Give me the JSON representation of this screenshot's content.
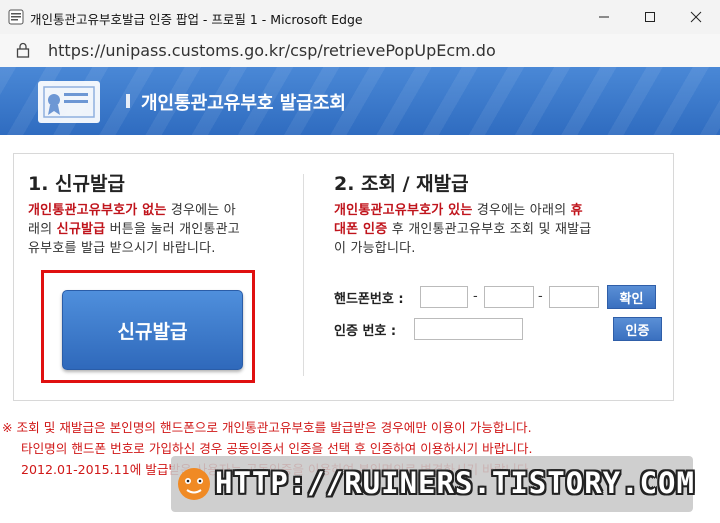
{
  "window": {
    "title": "개인통관고유부호발급 인증 팝업 - 프로필 1 - Microsoft Edge",
    "url": "https://unipass.customs.go.kr/csp/retrievePopUpEcm.do"
  },
  "banner": {
    "heading": "개인통관고유부호 발급조회"
  },
  "new_issue": {
    "heading": "1. 신규발급",
    "desc_red1": "개인통관고유부호가 없는",
    "desc_plain1": " 경우에는 아",
    "desc_plain2": "래의 ",
    "desc_red2": "신규발급",
    "desc_plain3": " 버튼을 눌러 개인통관고",
    "desc_plain4": "유부호를 발급 받으시기 바랍니다.",
    "button_label": "신규발급"
  },
  "lookup": {
    "heading": "2. 조회 / 재발급",
    "desc_red1": "개인통관고유부호가 있는",
    "desc_plain1": " 경우에는 아래의 ",
    "desc_red2": "휴",
    "desc_red3": "대폰 인증",
    "desc_plain2": " 후 개인통관고유부호 조회 및 재발급",
    "desc_plain3": "이 가능합니다.",
    "phone_label": "핸드폰번호 :",
    "dash": "-",
    "confirm_label": "확인",
    "auth_label": "인증  번호 :",
    "auth_button": "인증"
  },
  "notice": {
    "line1": "※ 조회 및 재발급은 본인명의 핸드폰으로 개인통관고유부호를 발급받은 경우에만 이용이 가능합니다.",
    "line2": "타인명의 핸드폰 번호로 가입하신 경우 공동인증서 인증을 선택 후 인증하여 이용하시기 바랍니다.",
    "line3": "2012.01-2015.11에 발급받은 사용자는 공동인증을 이용하여 본인명의로 변경하시기 바랍니다."
  },
  "watermark": {
    "text": "HTTP://RUINERS.TISTORY.COM"
  },
  "colors": {
    "accent": "#2f6cc0",
    "highlight": "#e01010",
    "notice": "#d01818"
  }
}
